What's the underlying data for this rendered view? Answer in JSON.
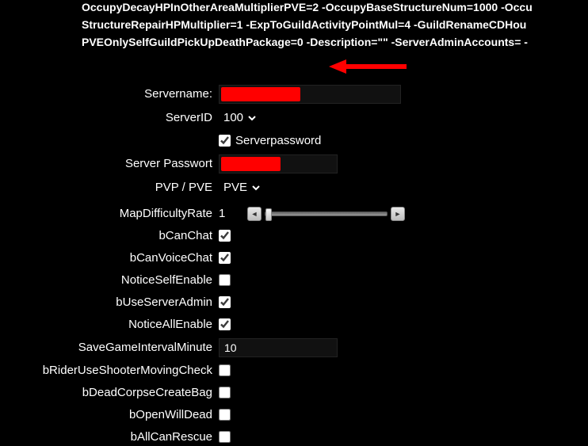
{
  "header_lines": [
    "OccupyDecayHPInOtherAreaMultiplierPVE=2 -OccupyBaseStructureNum=1000 -Occu",
    "StructureRepairHPMultiplier=1 -ExpToGuildActivityPointMul=4 -GuildRenameCDHou",
    "PVEOnlySelfGuildPickUpDeathPackage=0 -Description=\"\" -ServerAdminAccounts= -"
  ],
  "fields": {
    "servername": {
      "label": "Servername:",
      "value": ""
    },
    "serverid": {
      "label": "ServerID",
      "value": "100",
      "options": [
        "100"
      ]
    },
    "serverpassword_cb": {
      "label": "Serverpassword",
      "checked": true
    },
    "serverpasswort": {
      "label": "Server Passwort",
      "value": ""
    },
    "pvp_pve": {
      "label": "PVP / PVE",
      "value": "PVE",
      "options": [
        "PVE"
      ]
    },
    "mapdifficulty": {
      "label": "MapDifficultyRate",
      "value": "1"
    },
    "bcanchat": {
      "label": "bCanChat",
      "checked": true
    },
    "bcanvoicechat": {
      "label": "bCanVoiceChat",
      "checked": true
    },
    "noticeselfenable": {
      "label": "NoticeSelfEnable",
      "checked": false
    },
    "buseserveradmin": {
      "label": "bUseServerAdmin",
      "checked": true
    },
    "noticeallenable": {
      "label": "NoticeAllEnable",
      "checked": true
    },
    "savegameinterval": {
      "label": "SaveGameIntervalMinute",
      "value": "10"
    },
    "brideruseshootermovingcheck": {
      "label": "bRiderUseShooterMovingCheck",
      "checked": false
    },
    "bdeadcorpsecreatebag": {
      "label": "bDeadCorpseCreateBag",
      "checked": false
    },
    "bopenwilldead": {
      "label": "bOpenWillDead",
      "checked": false
    },
    "ballcanrescue": {
      "label": "bAllCanRescue",
      "checked": false
    }
  },
  "annotation": {
    "arrow_color": "#ff0000"
  }
}
